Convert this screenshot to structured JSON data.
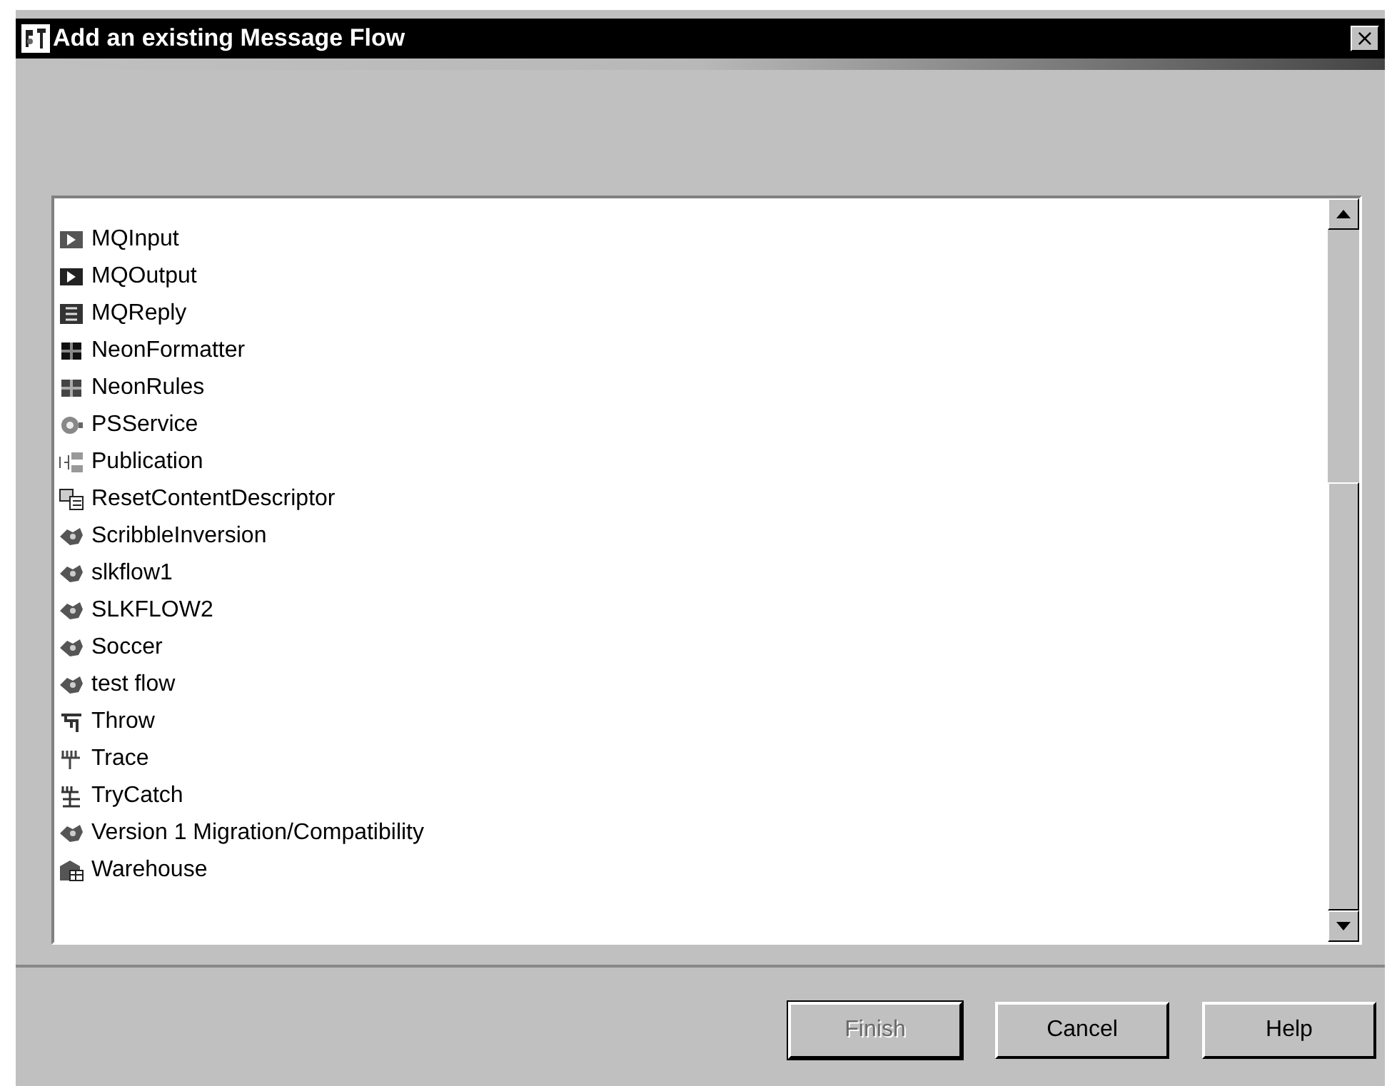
{
  "window": {
    "title": "Add an existing Message Flow",
    "close": "×"
  },
  "list": {
    "items": [
      {
        "label": "MQInput",
        "kind": "input"
      },
      {
        "label": "MQOutput",
        "kind": "output"
      },
      {
        "label": "MQReply",
        "kind": "reply"
      },
      {
        "label": "NeonFormatter",
        "kind": "formatter"
      },
      {
        "label": "NeonRules",
        "kind": "rules"
      },
      {
        "label": "PSService",
        "kind": "psservice"
      },
      {
        "label": "Publication",
        "kind": "publication"
      },
      {
        "label": "ResetContentDescriptor",
        "kind": "reset"
      },
      {
        "label": "ScribbleInversion",
        "kind": "flow"
      },
      {
        "label": "slkflow1",
        "kind": "flow"
      },
      {
        "label": "SLKFLOW2",
        "kind": "flow"
      },
      {
        "label": "Soccer",
        "kind": "flow"
      },
      {
        "label": "test flow",
        "kind": "flow"
      },
      {
        "label": "Throw",
        "kind": "throw"
      },
      {
        "label": "Trace",
        "kind": "trace"
      },
      {
        "label": "TryCatch",
        "kind": "trycatch"
      },
      {
        "label": "Version 1 Migration/Compatibility",
        "kind": "flow"
      },
      {
        "label": "Warehouse",
        "kind": "warehouse"
      }
    ]
  },
  "buttons": [
    {
      "label": "Finish",
      "disabled": true
    },
    {
      "label": "Cancel",
      "disabled": false
    },
    {
      "label": "Help",
      "disabled": false
    }
  ]
}
